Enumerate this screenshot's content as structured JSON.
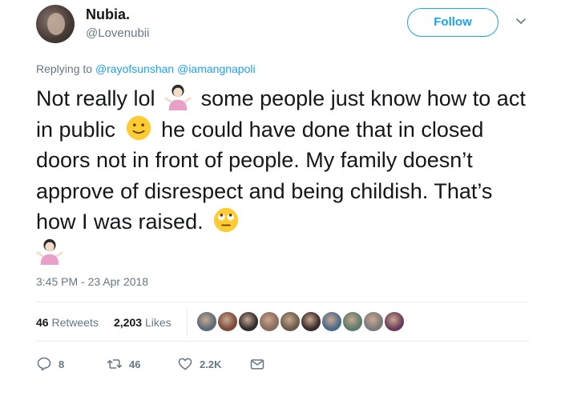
{
  "tweet": {
    "display_name": "Nubia.",
    "handle": "@Lovenubii",
    "follow_label": "Follow",
    "replying_to_prefix": "Replying to",
    "replying_to_users": [
      "@rayofsunshan",
      "@iamangnapoli"
    ],
    "text_parts": {
      "p1": "Not really lol",
      "p2": " some people just know how to act in public",
      "p3": " he could have done that in closed doors not in front of people. My family doesn’t approve of disrespect and being childish. That’s how I was raised."
    },
    "emojis": [
      "person-shrugging-emoji",
      "slightly-smiling-face-emoji",
      "face-with-rolling-eyes-emoji",
      "person-shrugging-emoji"
    ],
    "timestamp": "3:45 PM - 23 Apr 2018",
    "stats": {
      "retweets_count": "46",
      "retweets_label": "Retweets",
      "likes_count": "2,203",
      "likes_label": "Likes"
    },
    "liker_avatar_colors": [
      "#5a6b7a",
      "#7a4a3a",
      "#2d2d2d",
      "#8a6a5a",
      "#6b5a4a",
      "#3a2a2a",
      "#4a6a8a",
      "#5a7a6a",
      "#7a7a7a",
      "#6a3a5a"
    ],
    "actions": {
      "reply_count": "8",
      "retweet_count": "46",
      "like_count": "2.2K"
    },
    "colors": {
      "accent": "#1da1f2",
      "secondary_text": "#657786",
      "primary_text": "#14171a"
    }
  }
}
